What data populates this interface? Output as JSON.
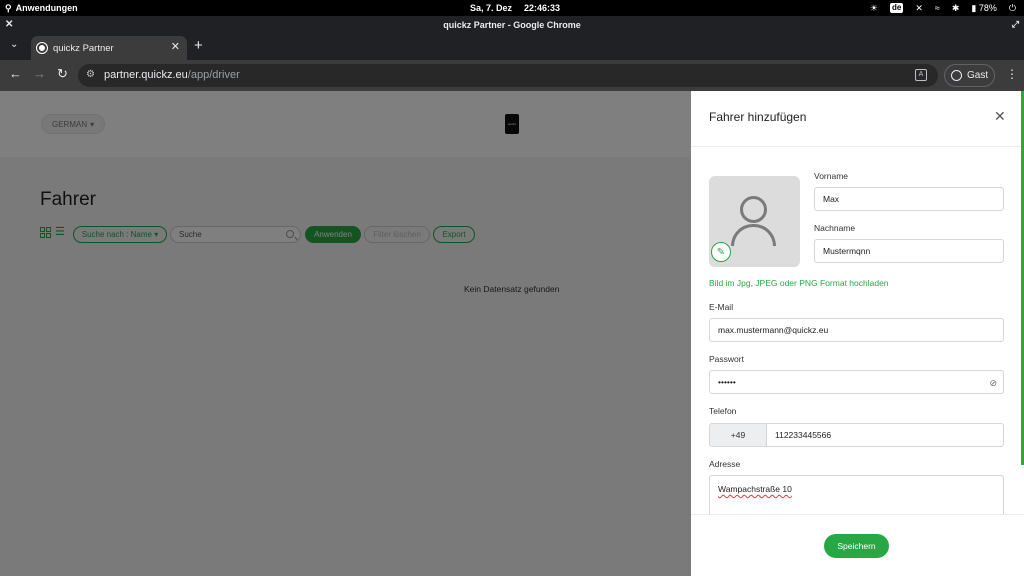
{
  "os": {
    "apps_label": "Anwendungen",
    "date": "Sa, 7. Dez",
    "time": "22:46:33",
    "lang": "de",
    "battery": "78%"
  },
  "window": {
    "title": "quickz Partner - Google Chrome"
  },
  "tab": {
    "title": "quickz Partner"
  },
  "address": {
    "host": "partner.quickz.eu",
    "path": "/app/driver",
    "guest_label": "Gast"
  },
  "page": {
    "language_button": "GERMAN",
    "title": "Fahrer",
    "search_by": "Suche nach : Name",
    "search_placeholder": "Suche",
    "apply_button": "Anwenden",
    "clear_filter_button": "Filter löschen",
    "export_button": "Export",
    "empty_message": "Kein Datensatz gefunden"
  },
  "panel": {
    "title": "Fahrer hinzufügen",
    "first_name_label": "Vorname",
    "first_name_value": "Max",
    "last_name_label": "Nachname",
    "last_name_value": "Mustermqnn",
    "upload_hint": "Bild im Jpg, JPEG oder PNG Format hochladen",
    "email_label": "E-Mail",
    "email_value": "max.mustermann@quickz.eu",
    "password_label": "Passwort",
    "password_value": "••••••",
    "phone_label": "Telefon",
    "phone_prefix": "+49",
    "phone_value": "112233445566",
    "address_label": "Adresse",
    "address_value": "Wampachstraße 10",
    "save_button": "Speichern"
  },
  "colors": {
    "accent": "#28a745"
  }
}
